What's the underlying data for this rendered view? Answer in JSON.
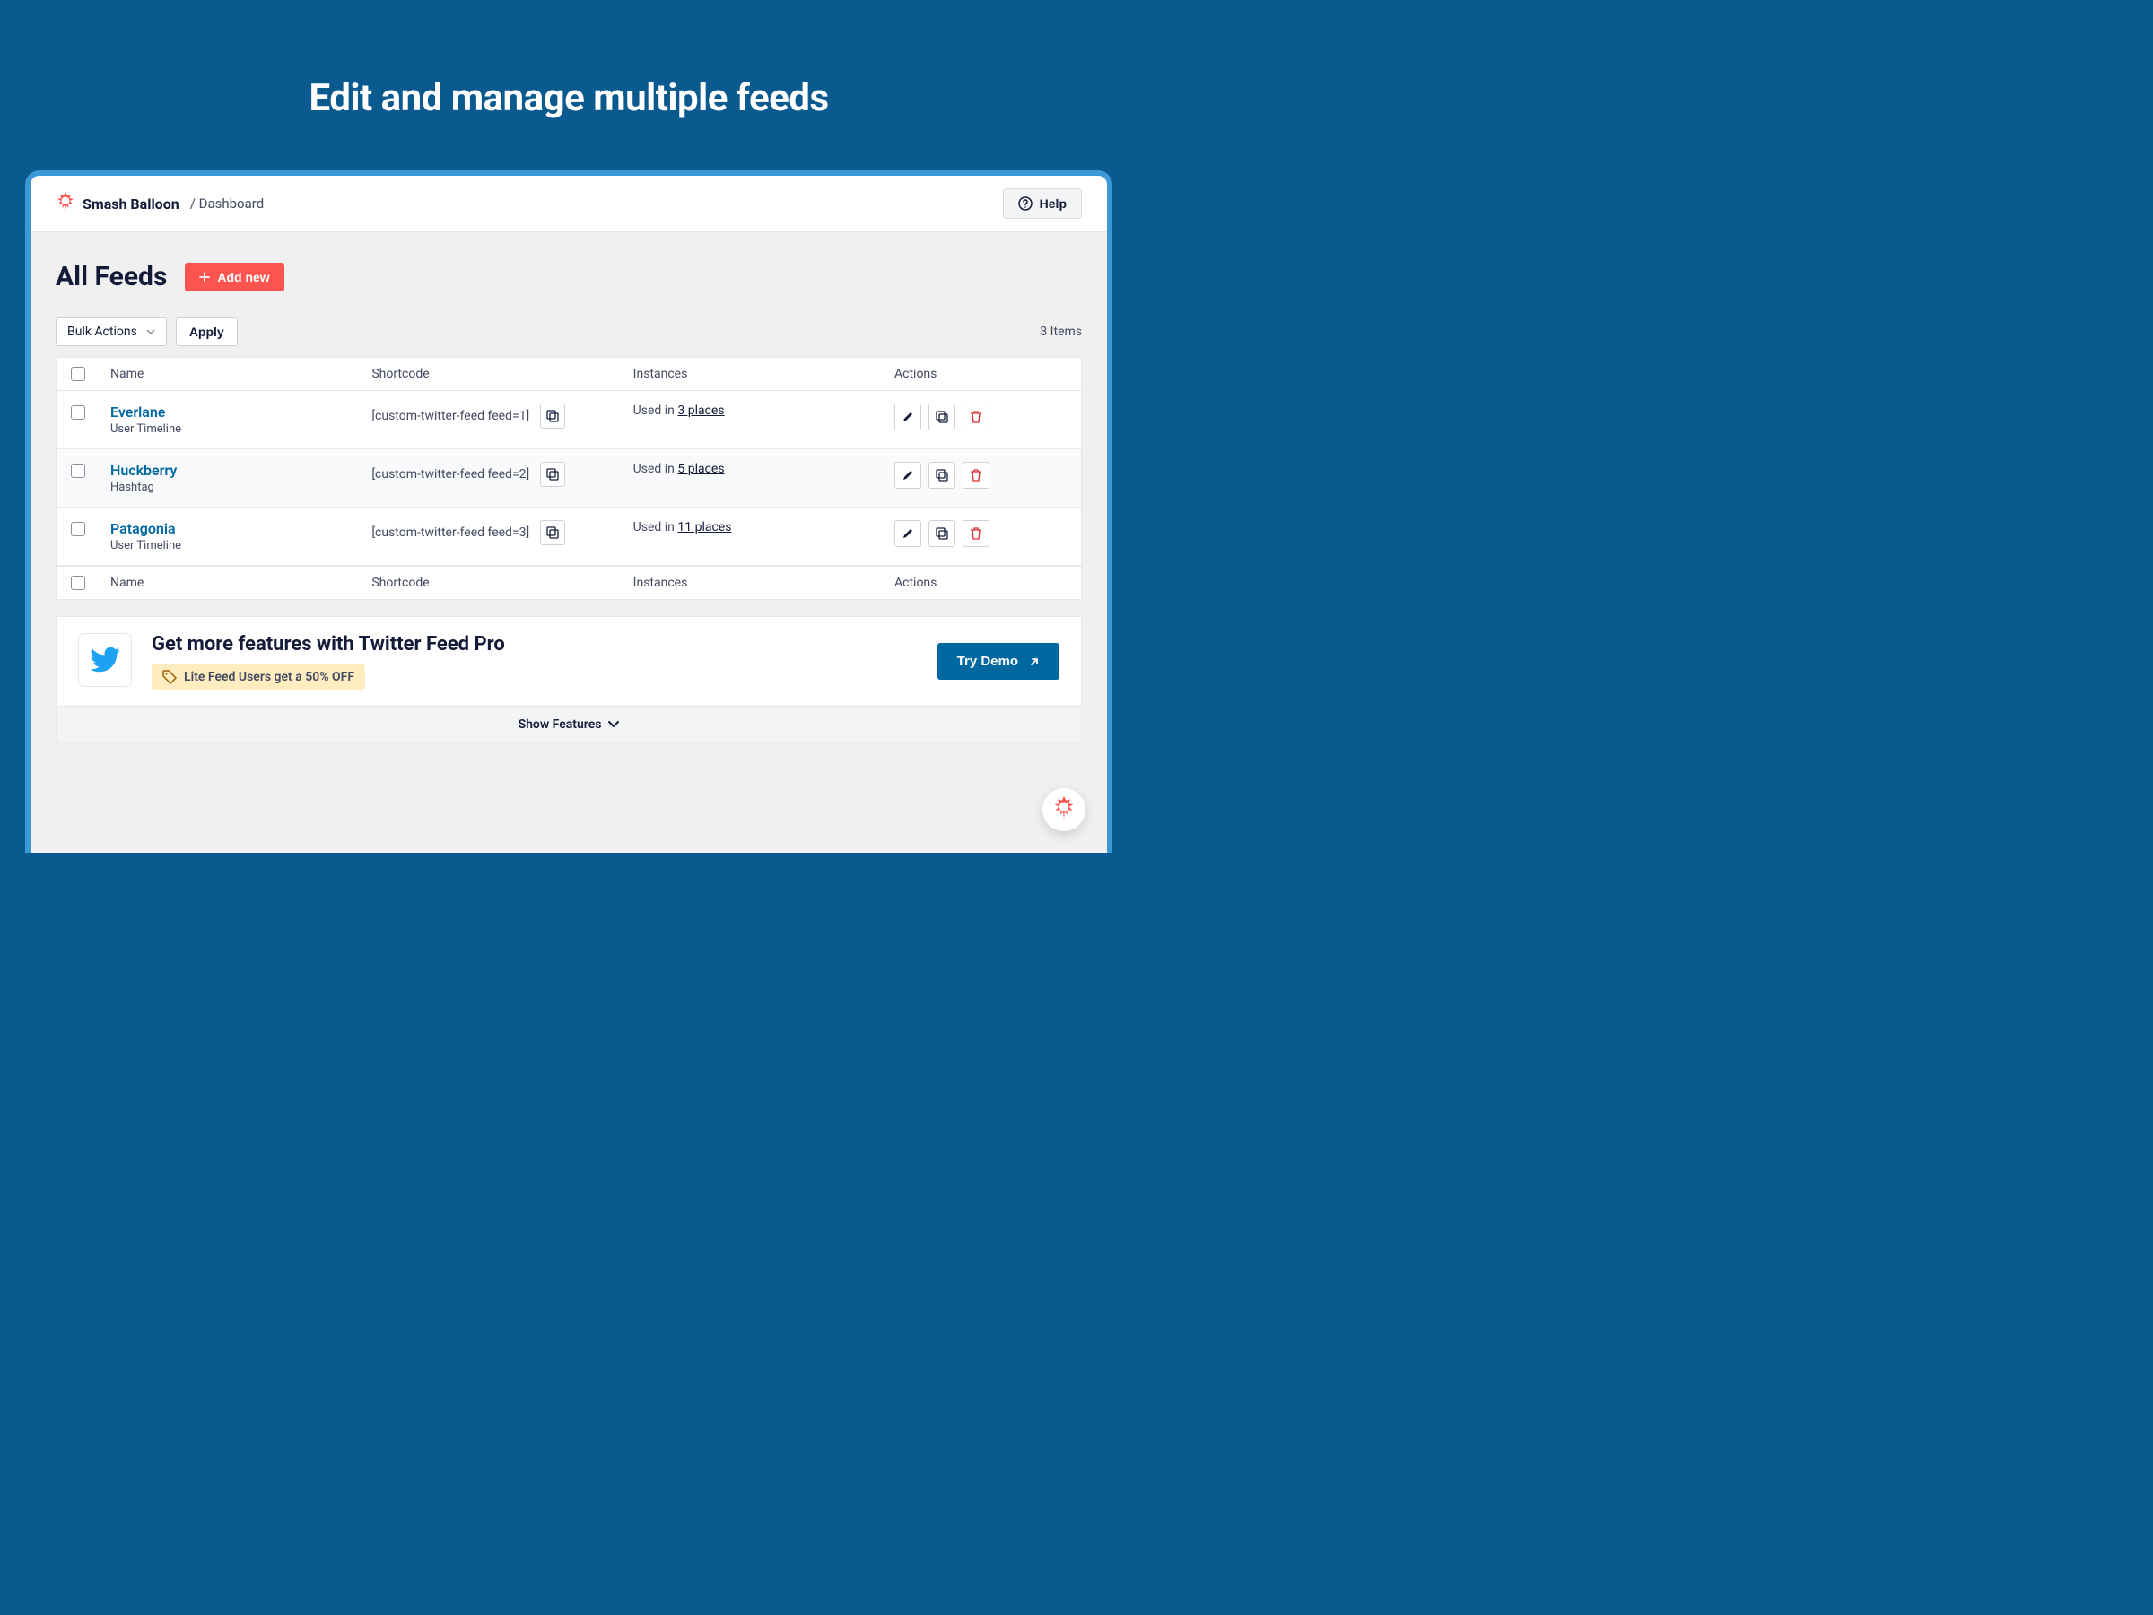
{
  "hero": {
    "title": "Edit and manage multiple feeds"
  },
  "header": {
    "brand": "Smash Balloon",
    "breadcrumb": "/ Dashboard",
    "help_label": "Help"
  },
  "page": {
    "title": "All Feeds",
    "add_new_label": "Add new",
    "bulk_actions_label": "Bulk Actions",
    "apply_label": "Apply",
    "items_count": "3 Items"
  },
  "columns": {
    "name": "Name",
    "shortcode": "Shortcode",
    "instances": "Instances",
    "actions": "Actions"
  },
  "feeds": [
    {
      "name": "Everlane",
      "type": "User Timeline",
      "shortcode": "[custom-twitter-feed feed=1]",
      "instances_prefix": "Used in ",
      "instances_link": "3 places"
    },
    {
      "name": "Huckberry",
      "type": "Hashtag",
      "shortcode": "[custom-twitter-feed feed=2]",
      "instances_prefix": "Used in ",
      "instances_link": "5 places"
    },
    {
      "name": "Patagonia",
      "type": "User Timeline",
      "shortcode": "[custom-twitter-feed feed=3]",
      "instances_prefix": "Used in ",
      "instances_link": "11 places"
    }
  ],
  "promo": {
    "title": "Get more features with Twitter Feed Pro",
    "badge": "Lite Feed Users get a 50% OFF",
    "cta": "Try Demo",
    "show_features": "Show Features"
  },
  "colors": {
    "bg": "#0a5a8f",
    "frame": "#3b98d4",
    "accent_red": "#fe544f",
    "link": "#0068a0",
    "twitter": "#1da1f2"
  }
}
